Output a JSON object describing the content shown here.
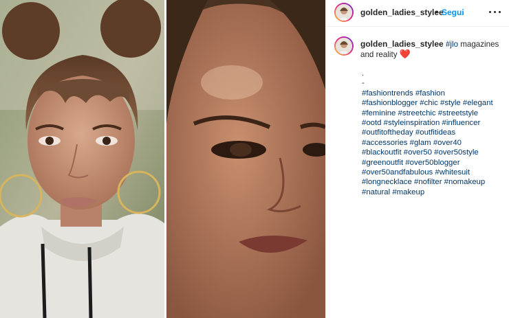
{
  "post": {
    "username": "golden_ladies_stylee",
    "separator": "•",
    "follow_label": "Segui",
    "more_icon": "more-horizontal-icon"
  },
  "caption": {
    "username": "golden_ladies_stylee",
    "hashtag": "#jlo",
    "text": " magazines and reality ",
    "heart": "❤️"
  },
  "hashtags": {
    "dot": ".",
    "dash": "-",
    "lines": [
      "#fashiontrends #fashion",
      "#fashionblogger #chic #style #elegant",
      "#feminine #streetchic #streetstyle",
      "#ootd #styleinspiration #influencer",
      "#outfitoftheday #outfitideas",
      "#accessories #glam #over40",
      "#blackoutfit #over50 #over50style",
      "#greenoutfit #over50blogger",
      "#over50andfabulous #whitesuit",
      "#longnecklace #nofilter #nomakeup",
      "#natural #makeup"
    ]
  }
}
